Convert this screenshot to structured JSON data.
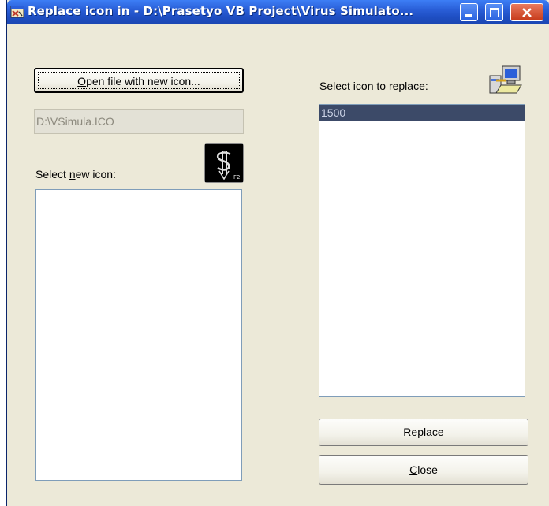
{
  "window": {
    "title": "Replace icon in - D:\\Prasetyo VB Project\\Virus Simulato...",
    "controls": [
      "minimize",
      "maximize",
      "close"
    ]
  },
  "left": {
    "open_button": {
      "label_pre": "",
      "label_access": "O",
      "label_post": "pen file with new icon..."
    },
    "file_field": {
      "value": "D:\\VSimula.ICO"
    },
    "select_new_label": {
      "pre": "Select ",
      "access": "n",
      "post": "ew icon:"
    },
    "new_icon_items": []
  },
  "right": {
    "select_replace_label": {
      "pre": "Select icon to repl",
      "access": "a",
      "post": "ce:"
    },
    "icon_items": [
      "1500"
    ],
    "selected_index": 0,
    "replace_button": {
      "access": "R",
      "post": "eplace"
    },
    "close_button": {
      "access": "C",
      "post": "lose"
    }
  },
  "icons": {
    "app_icon": "app-window-icon",
    "preview_icon": "dollar-pen-icon",
    "resource_icon": "computer-icon"
  },
  "colors": {
    "titlebar": "#2a5fd8",
    "dialog_bg": "#ece9d8",
    "close_red": "#c73a1a",
    "selection": "#3c4a68"
  }
}
